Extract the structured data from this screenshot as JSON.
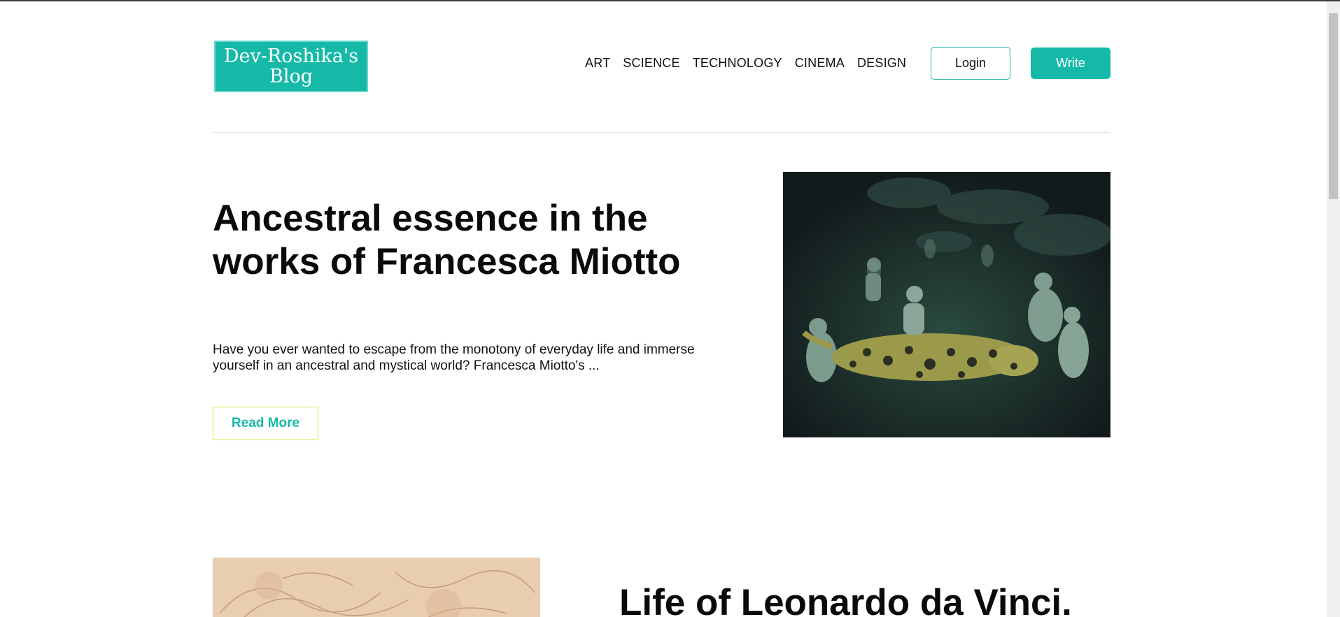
{
  "header": {
    "logo_text": "Dev-Roshika's Blog",
    "nav": [
      {
        "label": "ART"
      },
      {
        "label": "SCIENCE"
      },
      {
        "label": "TECHNOLOGY"
      },
      {
        "label": "CINEMA"
      },
      {
        "label": "DESIGN"
      }
    ],
    "login_label": "Login",
    "write_label": "Write"
  },
  "posts": [
    {
      "title": "Ancestral essence in the works of Francesca Miotto",
      "excerpt": "Have you ever wanted to escape from the monotony of everyday life and immerse yourself in an ancestral and mystical world? Francesca Miotto's ...",
      "read_more": "Read More",
      "image": "painting-children-with-jaguar"
    },
    {
      "title": "Life of Leonardo da Vinci.",
      "image": "sepia-sketch"
    }
  ],
  "colors": {
    "accent": "#16b9a8",
    "read_more_border": "#d4e84a"
  }
}
